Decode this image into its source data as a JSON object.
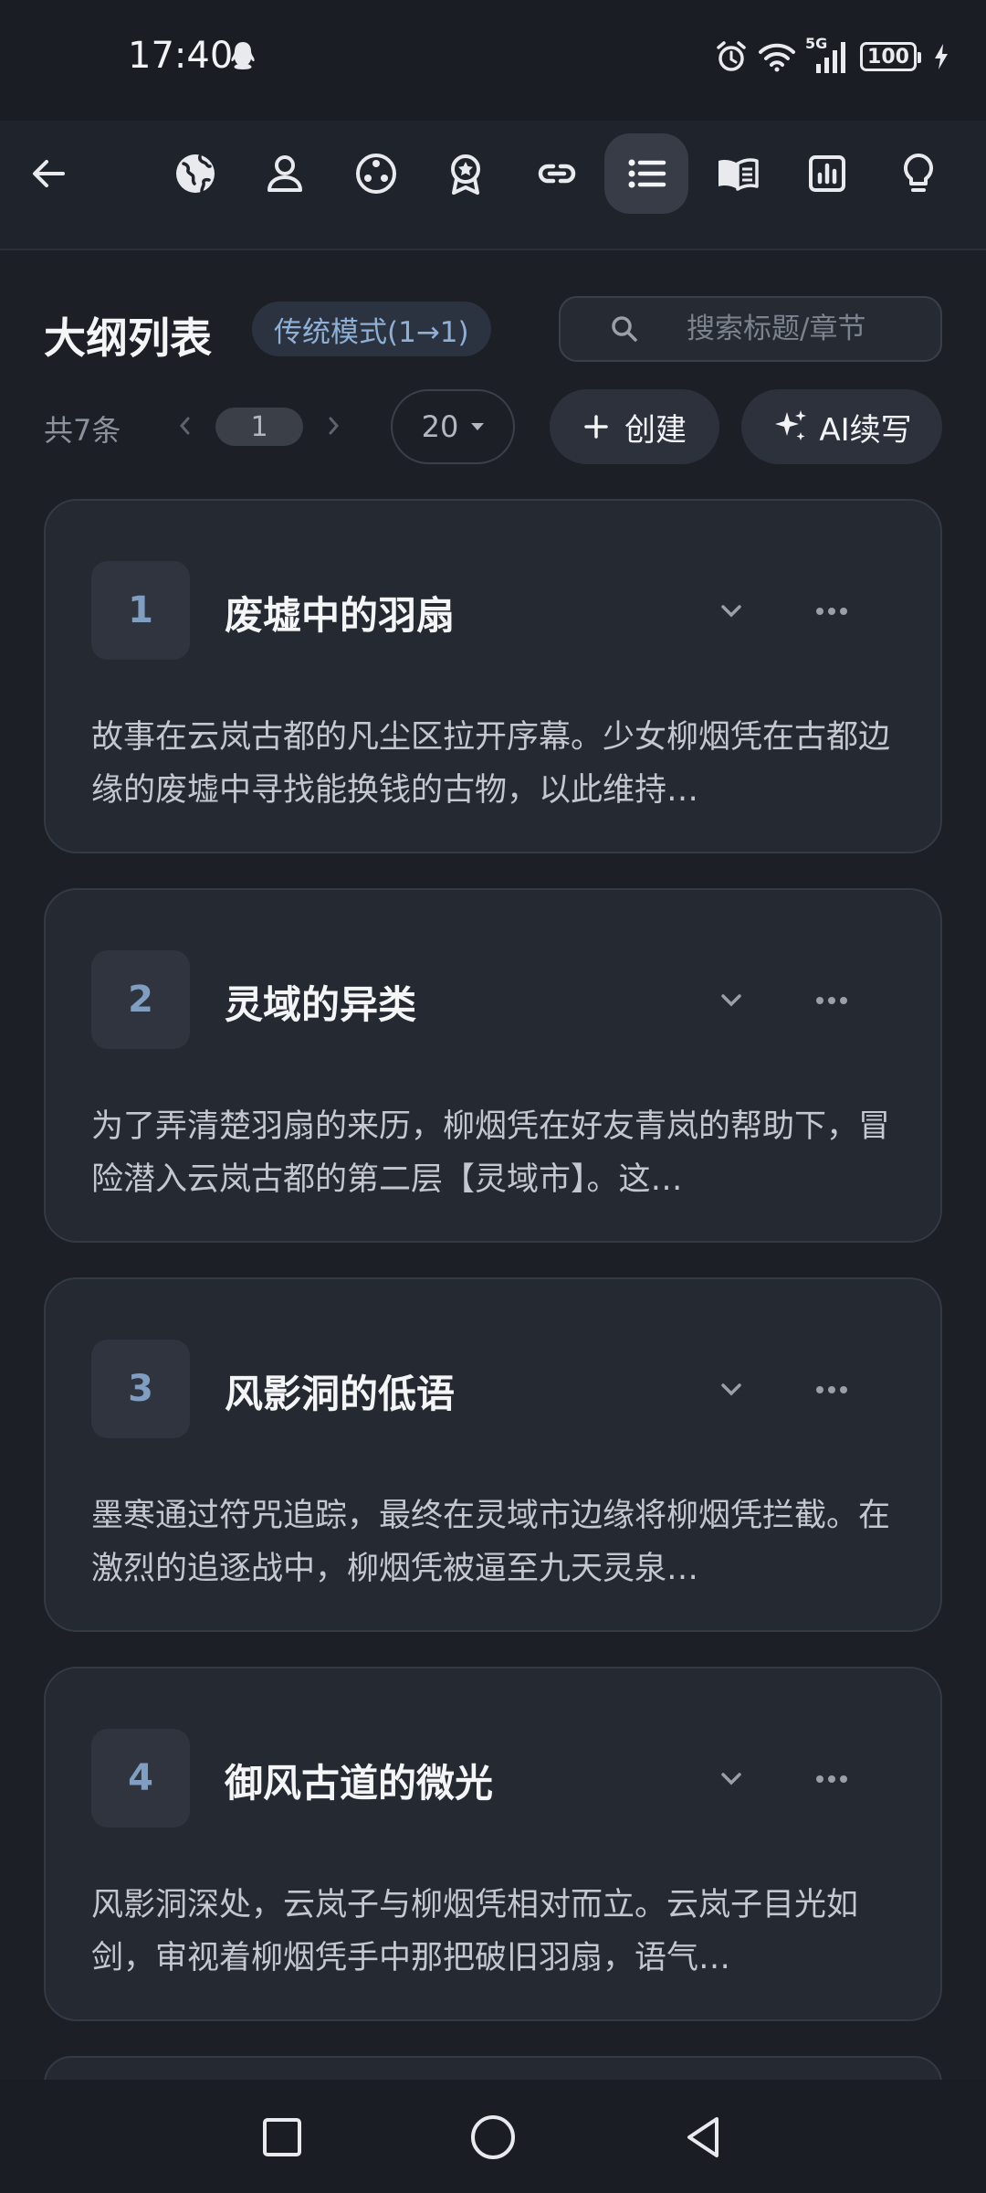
{
  "status": {
    "time": "17:40",
    "network": "5G",
    "battery": "100"
  },
  "toolbar": {
    "icons": [
      "back-arrow-icon",
      "globe-icon",
      "user-icon",
      "palette-icon",
      "award-icon",
      "link-icon",
      "list-icon",
      "book-icon",
      "chart-icon",
      "lightbulb-icon"
    ],
    "active": "list-icon"
  },
  "header": {
    "title": "大纲列表",
    "mode": "传统模式(1→1)",
    "search_placeholder": "搜索标题/章节"
  },
  "pagination": {
    "total": "共7条",
    "current_page": "1",
    "page_size": "20"
  },
  "actions": {
    "create_label": "创建",
    "ai_label": "AI续写"
  },
  "outlines": [
    {
      "num": "1",
      "title": "废墟中的羽扇",
      "desc": "故事在云岚古都的凡尘区拉开序幕。少女柳烟凭在古都边缘的废墟中寻找能换钱的古物，以此维持…"
    },
    {
      "num": "2",
      "title": "灵域的异类",
      "desc": "为了弄清楚羽扇的来历，柳烟凭在好友青岚的帮助下，冒险潜入云岚古都的第二层【灵域市】。这…"
    },
    {
      "num": "3",
      "title": "风影洞的低语",
      "desc": "墨寒通过符咒追踪，最终在灵域市边缘将柳烟凭拦截。在激烈的追逐战中，柳烟凭被逼至九天灵泉…"
    },
    {
      "num": "4",
      "title": "御风古道的微光",
      "desc": "风影洞深处，云岚子与柳烟凭相对而立。云岚子目光如剑，审视着柳烟凭手中那把破旧羽扇，语气…"
    }
  ],
  "colors": {
    "background": "#1c1f26",
    "card": "#252931",
    "accent": "#8fb0d6",
    "number": "#7f9ec2"
  }
}
